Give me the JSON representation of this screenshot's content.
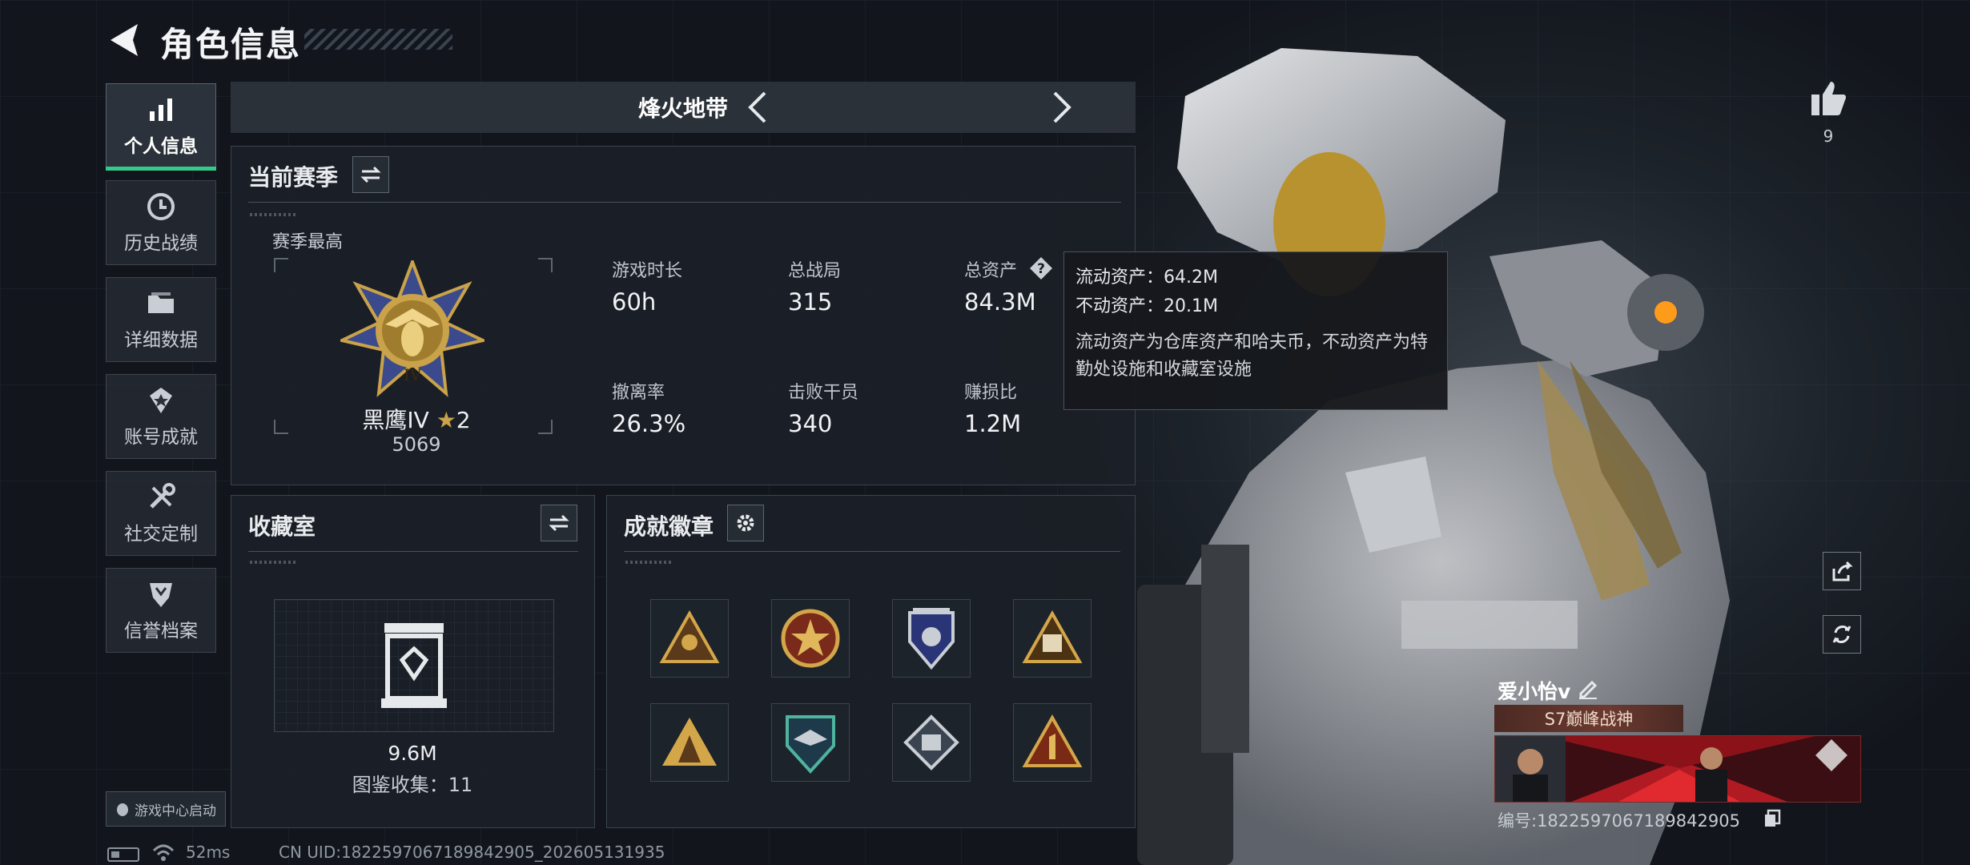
{
  "header": {
    "title": "角色信息"
  },
  "sidebar": {
    "items": [
      {
        "label": "个人信息",
        "icon": "bar-chart-icon",
        "active": true
      },
      {
        "label": "历史战绩",
        "icon": "history-clock-icon"
      },
      {
        "label": "详细数据",
        "icon": "folder-icon"
      },
      {
        "label": "账号成就",
        "icon": "achievement-medal-icon"
      },
      {
        "label": "社交定制",
        "icon": "tools-icon"
      },
      {
        "label": "信誉档案",
        "icon": "shield-icon"
      }
    ],
    "launch_label": "游戏中心启动"
  },
  "mode": {
    "name": "烽火地带"
  },
  "season": {
    "title": "当前赛季",
    "best_label": "赛季最高",
    "rank_name": "黑鹰IV",
    "rank_stars": "2",
    "rank_score": "5069",
    "stats": [
      {
        "label": "游戏时长",
        "value": "60h"
      },
      {
        "label": "总战局",
        "value": "315"
      },
      {
        "label": "总资产",
        "value": "84.3M"
      },
      {
        "label": "撤离率",
        "value": "26.3%"
      },
      {
        "label": "击败干员",
        "value": "340"
      },
      {
        "label": "赚损比",
        "value": "1.2M"
      }
    ]
  },
  "tooltip": {
    "liquid": "流动资产：64.2M",
    "fixed": "不动资产：20.1M",
    "desc": "流动资产为仓库资产和哈夫币，不动资产为特勤处设施和收藏室设施"
  },
  "collection": {
    "title": "收藏室",
    "value": "9.6M",
    "count": "图鉴收集：11"
  },
  "badges": {
    "title": "成就徽章",
    "items": [
      "triangle-badge-icon",
      "star-medal-icon",
      "police-shield-icon",
      "fortress-badge-icon",
      "soldier-triangle-icon",
      "eagle-shield-icon",
      "diamond-crest-icon",
      "number-one-triangle-icon"
    ]
  },
  "profile": {
    "likes": "9",
    "name": "爱小怡v",
    "title_badge": "S7巅峰战神",
    "uid": "编号:1822597067189842905"
  },
  "status": {
    "ping": "52ms",
    "cn_uid": "CN UID:1822597067189842905_202605131935"
  },
  "colors": {
    "accent_green": "#35c98a",
    "panel": "#1b2027",
    "gold": "#c9a24a"
  }
}
